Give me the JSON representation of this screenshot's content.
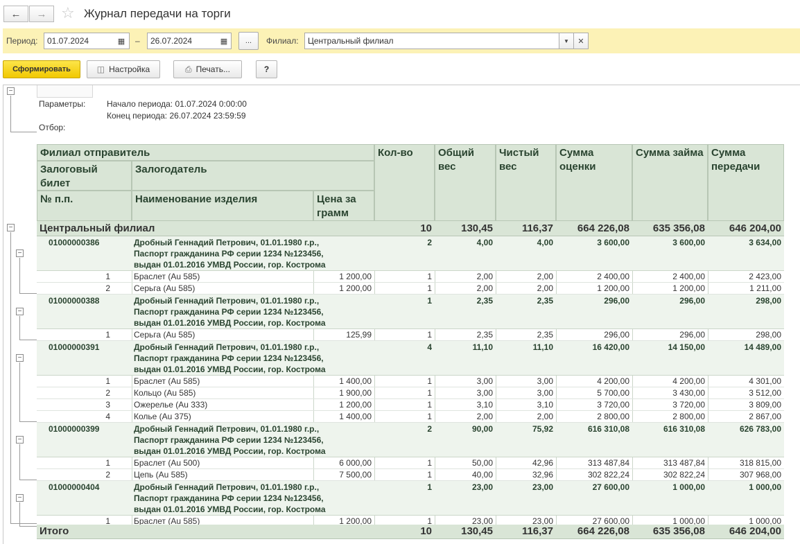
{
  "window": {
    "title": "Журнал передачи на торги",
    "back_icon": "arrow-left-icon",
    "forward_icon": "arrow-right-icon",
    "favorite_icon": "star-icon"
  },
  "filter": {
    "period_label": "Период:",
    "date_from": "01.07.2024",
    "dash": "–",
    "date_to": "26.07.2024",
    "more_btn": "...",
    "branch_label": "Филиал:",
    "branch_value": "Центральный филиал",
    "bg_color": "#fcf2b6"
  },
  "toolbar": {
    "generate": "Сформировать",
    "settings": "Настройка",
    "print": "Печать...",
    "help": "?"
  },
  "params": {
    "label": "Параметры:",
    "start": "Начало периода: 01.07.2024 0:00:00",
    "end": "Конец периода: 26.07.2024 23:59:59",
    "filter_label": "Отбор:"
  },
  "headers": {
    "branch": "Филиал отправитель",
    "ticket": "Залоговый билет",
    "pledger": "Залогодатель",
    "num": "№ п.п.",
    "item_name": "Наименование изделия",
    "price_gram": "Цена за грамм",
    "qty": "Кол-во",
    "gross_weight": "Общий вес",
    "net_weight": "Чистый вес",
    "appraisal": "Сумма оценки",
    "loan": "Сумма займа",
    "transfer": "Сумма передачи"
  },
  "group": {
    "name": "Центральный филиал",
    "qty": "10",
    "gross": "130,45",
    "net": "116,37",
    "appraisal": "664 226,08",
    "loan": "635 356,08",
    "transfer": "646 204,00"
  },
  "tickets": [
    {
      "number": "01000000386",
      "pledger": [
        "Дробный Геннадий Петрович, 01.01.1980 г.р.,",
        "Паспорт гражданина РФ серии 1234 №123456,",
        "выдан 01.01.2016 УМВД России, гор. Кострома"
      ],
      "qty": "2",
      "gross": "4,00",
      "net": "4,00",
      "appraisal": "3 600,00",
      "loan": "3 600,00",
      "transfer": "3 634,00",
      "items": [
        {
          "n": "1",
          "name": "Браслет (Au 585)",
          "price": "1 200,00",
          "qty": "1",
          "gross": "2,00",
          "net": "2,00",
          "appraisal": "2 400,00",
          "loan": "2 400,00",
          "transfer": "2 423,00"
        },
        {
          "n": "2",
          "name": "Серьга (Au 585)",
          "price": "1 200,00",
          "qty": "1",
          "gross": "2,00",
          "net": "2,00",
          "appraisal": "1 200,00",
          "loan": "1 200,00",
          "transfer": "1 211,00"
        }
      ]
    },
    {
      "number": "01000000388",
      "pledger": [
        "Дробный Геннадий Петрович, 01.01.1980 г.р.,",
        "Паспорт гражданина РФ серии 1234 №123456,",
        "выдан 01.01.2016 УМВД России, гор. Кострома"
      ],
      "qty": "1",
      "gross": "2,35",
      "net": "2,35",
      "appraisal": "296,00",
      "loan": "296,00",
      "transfer": "298,00",
      "items": [
        {
          "n": "1",
          "name": "Серьга (Au 585)",
          "price": "125,99",
          "qty": "1",
          "gross": "2,35",
          "net": "2,35",
          "appraisal": "296,00",
          "loan": "296,00",
          "transfer": "298,00"
        }
      ]
    },
    {
      "number": "01000000391",
      "pledger": [
        "Дробный Геннадий Петрович, 01.01.1980 г.р.,",
        "Паспорт гражданина РФ серии 1234 №123456,",
        "выдан 01.01.2016 УМВД России, гор. Кострома"
      ],
      "qty": "4",
      "gross": "11,10",
      "net": "11,10",
      "appraisal": "16 420,00",
      "loan": "14 150,00",
      "transfer": "14 489,00",
      "items": [
        {
          "n": "1",
          "name": "Браслет (Au 585)",
          "price": "1 400,00",
          "qty": "1",
          "gross": "3,00",
          "net": "3,00",
          "appraisal": "4 200,00",
          "loan": "4 200,00",
          "transfer": "4 301,00"
        },
        {
          "n": "2",
          "name": "Кольцо (Au 585)",
          "price": "1 900,00",
          "qty": "1",
          "gross": "3,00",
          "net": "3,00",
          "appraisal": "5 700,00",
          "loan": "3 430,00",
          "transfer": "3 512,00"
        },
        {
          "n": "3",
          "name": "Ожерелье (Au 333)",
          "price": "1 200,00",
          "qty": "1",
          "gross": "3,10",
          "net": "3,10",
          "appraisal": "3 720,00",
          "loan": "3 720,00",
          "transfer": "3 809,00"
        },
        {
          "n": "4",
          "name": "Колье (Au 375)",
          "price": "1 400,00",
          "qty": "1",
          "gross": "2,00",
          "net": "2,00",
          "appraisal": "2 800,00",
          "loan": "2 800,00",
          "transfer": "2 867,00"
        }
      ]
    },
    {
      "number": "01000000399",
      "pledger": [
        "Дробный Геннадий Петрович, 01.01.1980 г.р.,",
        "Паспорт гражданина РФ серии 1234 №123456,",
        "выдан 01.01.2016 УМВД России, гор. Кострома"
      ],
      "qty": "2",
      "gross": "90,00",
      "net": "75,92",
      "appraisal": "616 310,08",
      "loan": "616 310,08",
      "transfer": "626 783,00",
      "items": [
        {
          "n": "1",
          "name": "Браслет (Au 500)",
          "price": "6 000,00",
          "qty": "1",
          "gross": "50,00",
          "net": "42,96",
          "appraisal": "313 487,84",
          "loan": "313 487,84",
          "transfer": "318 815,00"
        },
        {
          "n": "2",
          "name": "Цепь (Au 585)",
          "price": "7 500,00",
          "qty": "1",
          "gross": "40,00",
          "net": "32,96",
          "appraisal": "302 822,24",
          "loan": "302 822,24",
          "transfer": "307 968,00"
        }
      ]
    },
    {
      "number": "01000000404",
      "pledger": [
        "Дробный Геннадий Петрович, 01.01.1980 г.р.,",
        "Паспорт гражданина РФ серии 1234 №123456,",
        "выдан 01.01.2016 УМВД России, гор. Кострома"
      ],
      "qty": "1",
      "gross": "23,00",
      "net": "23,00",
      "appraisal": "27 600,00",
      "loan": "1 000,00",
      "transfer": "1 000,00",
      "items": [
        {
          "n": "1",
          "name": "Браслет (Au 585)",
          "price": "1 200,00",
          "qty": "1",
          "gross": "23,00",
          "net": "23,00",
          "appraisal": "27 600,00",
          "loan": "1 000,00",
          "transfer": "1 000,00"
        }
      ]
    }
  ],
  "total": {
    "label": "Итого",
    "qty": "10",
    "gross": "130,45",
    "net": "116,37",
    "appraisal": "664 226,08",
    "loan": "635 356,08",
    "transfer": "646 204,00"
  }
}
